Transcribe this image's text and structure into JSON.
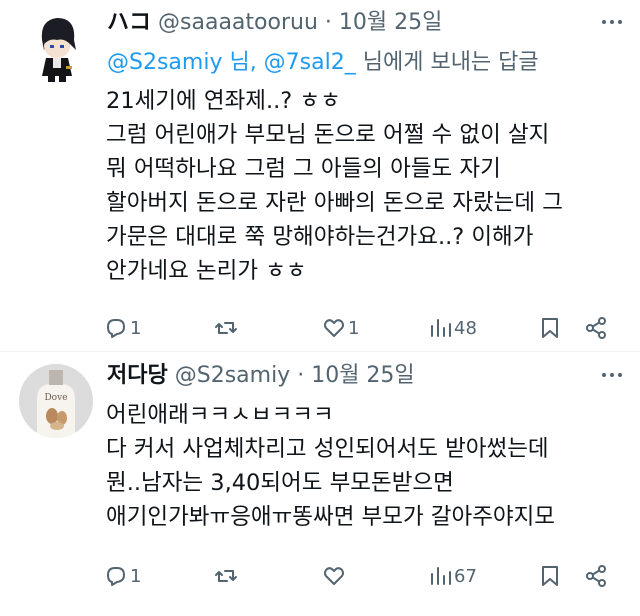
{
  "tweets": [
    {
      "name": "ハコ",
      "handle": "@saaaatooruu",
      "dot": "·",
      "date": "10월 25일",
      "reply_prefix": "@S2samiy 님, @7sal2_",
      "reply_suffix": " 님에게 보내는 답글",
      "lines": [
        "21세기에 연좌제..? ㅎㅎ",
        "그럼 어린애가 부모님 돈으로 어쩔 수 없이 살지",
        "뭐 어떡하나요 그럼 그 아들의 아들도 자기",
        "할아버지 돈으로 자란 아빠의 돈으로 자랐는데 그",
        "가문은 대대로 쭉 망해야하는건가요..? 이해가",
        "안가네요 논리가 ㅎㅎ"
      ],
      "replies": "1",
      "retweets": "",
      "likes": "1",
      "views": "48"
    },
    {
      "name": "저다당",
      "handle": "@S2samiy",
      "dot": "·",
      "date": "10월 25일",
      "lines": [
        "어린애래ㅋㅋㅅㅂㅋㅋㅋ",
        "다 커서 사업체차리고 성인되어서도 받아썼는데",
        "뭔..남자는 3,40되어도 부모돈받으면",
        "애기인가봐ㅠ응애ㅠ똥싸면 부모가 갈아주야지모"
      ],
      "replies": "1",
      "retweets": "",
      "likes": "",
      "views": "67"
    }
  ],
  "colors": {
    "text": "#0f1419",
    "secondary": "#536471",
    "link": "#1d9bf0",
    "divider": "#eff3f4"
  },
  "icons": {
    "reply": "reply-icon",
    "retweet": "retweet-icon",
    "like": "heart-icon",
    "views": "views-icon",
    "bookmark": "bookmark-icon",
    "share": "share-icon",
    "more": "more-icon"
  }
}
